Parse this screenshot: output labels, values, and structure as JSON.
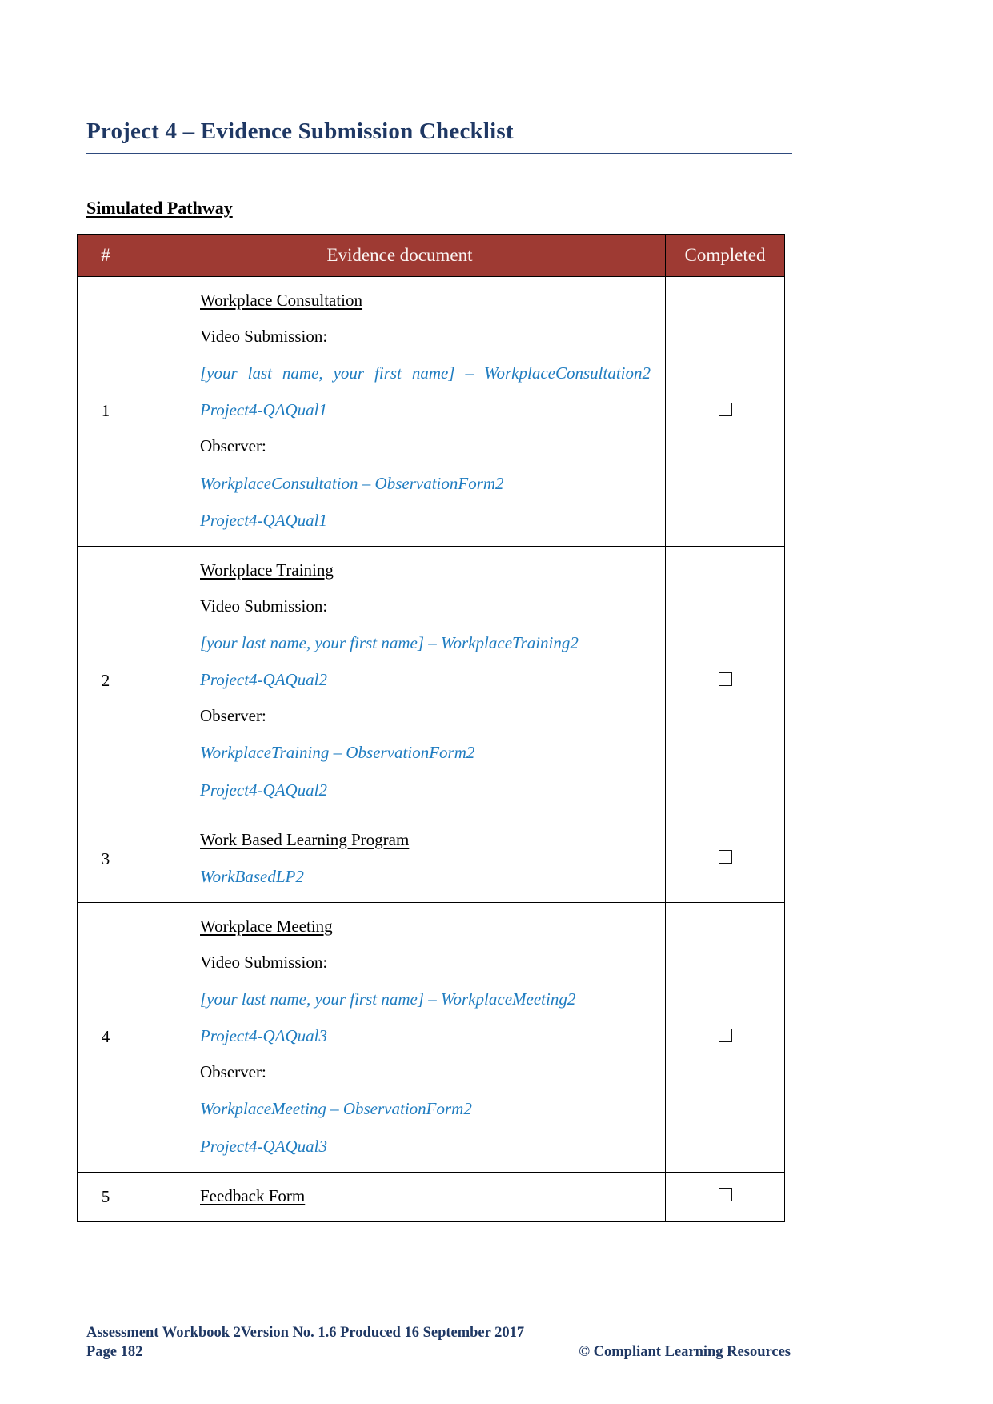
{
  "document": {
    "title": "Project 4 – Evidence Submission Checklist",
    "sub_heading": "Simulated Pathway"
  },
  "table": {
    "headers": {
      "num": "#",
      "document": "Evidence document",
      "completed": "Completed"
    },
    "rows": [
      {
        "num": "1",
        "heading": "Workplace Consultation",
        "label1": "Video Submission:",
        "blue1": "[your last name, your first name] –  WorkplaceConsultation2",
        "blue2": "Project4-QAQual1",
        "label2": "Observer:",
        "blue3": "WorkplaceConsultation – ObservationForm2",
        "blue4": "Project4-QAQual1",
        "checkbox": "unchecked"
      },
      {
        "num": "2",
        "heading": "Workplace Training",
        "label1": "Video Submission:",
        "blue1": "[your last name, your first name] – WorkplaceTraining2",
        "blue2": "Project4-QAQual2",
        "label2": "Observer:",
        "blue3": "WorkplaceTraining – ObservationForm2",
        "blue4": "Project4-QAQual2",
        "checkbox": "unchecked"
      },
      {
        "num": "3",
        "heading": "Work Based Learning Program",
        "blue1": "WorkBasedLP2",
        "checkbox": "unchecked"
      },
      {
        "num": "4",
        "heading": "Workplace Meeting",
        "label1": "Video Submission:",
        "blue1": "[your last name, your first name] – WorkplaceMeeting2",
        "blue2": "Project4-QAQual3",
        "label2": "Observer:",
        "blue3": "WorkplaceMeeting – ObservationForm2",
        "blue4": "Project4-QAQual3",
        "checkbox": "unchecked"
      },
      {
        "num": "5",
        "heading": "Feedback Form",
        "checkbox": "unchecked"
      }
    ]
  },
  "footer": {
    "line1": "Assessment Workbook 2Version No. 1.6 Produced 16 September 2017",
    "page": "Page 182",
    "copyright": "© Compliant Learning Resources"
  },
  "colors": {
    "title": "#1F3864",
    "table_header_bg": "#9E3A33",
    "blue_text": "#1F7CC0"
  }
}
